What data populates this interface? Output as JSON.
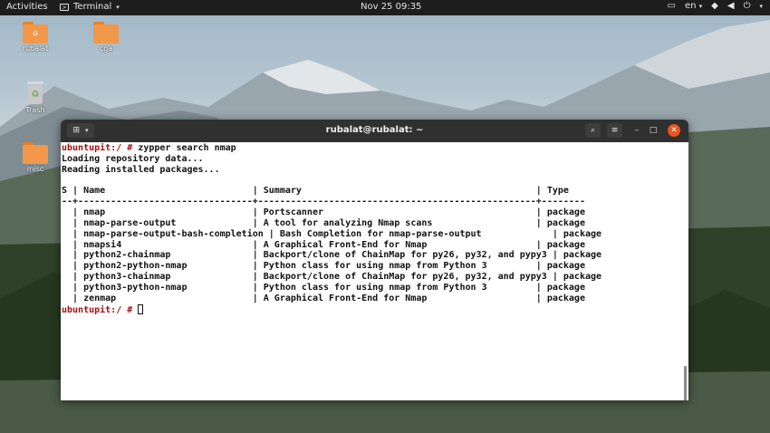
{
  "topbar": {
    "activities": "Activities",
    "app_name": "Terminal",
    "clock": "Nov 25  09:35",
    "language": "en",
    "icons": [
      "terminal-icon",
      "display-icon",
      "network-icon",
      "volume-icon",
      "power-icon"
    ]
  },
  "desktop": {
    "icons": [
      {
        "label": "rubalat",
        "icon": "home-folder-icon"
      },
      {
        "label": "cga",
        "icon": "folder-icon"
      },
      {
        "label": "Trash",
        "icon": "trash-icon"
      },
      {
        "label": "misc",
        "icon": "folder-icon"
      }
    ]
  },
  "window": {
    "title": "rubalat@rubalat: ~",
    "controls": [
      "new-tab-icon",
      "search-icon",
      "hamburger-menu-icon",
      "minimize-icon",
      "maximize-icon",
      "close-icon"
    ],
    "accent_close": "#e95420"
  },
  "terminal": {
    "prompt": "ubuntupit:/ #",
    "command": " zypper search nmap",
    "lines": [
      "Loading repository data...",
      "Reading installed packages...",
      "",
      "S | Name                           | Summary                                           | Type",
      "--+--------------------------------+---------------------------------------------------+--------",
      "  | nmap                           | Portscanner                                       | package",
      "  | nmap-parse-output              | A tool for analyzing Nmap scans                   | package",
      "  | nmap-parse-output-bash-completion | Bash Completion for nmap-parse-output             | package",
      "  | nmapsi4                        | A Graphical Front-End for Nmap                    | package",
      "  | python2-chainmap               | Backport/clone of ChainMap for py26, py32, and pypy3 | package",
      "  | python2-python-nmap            | Python class for using nmap from Python 3         | package",
      "  | python3-chainmap               | Backport/clone of ChainMap for py26, py32, and pypy3 | package",
      "  | python3-python-nmap            | Python class for using nmap from Python 3         | package",
      "  | zenmap                         | A Graphical Front-End for Nmap                    | package"
    ],
    "final_prompt": "ubuntupit:/ #"
  }
}
